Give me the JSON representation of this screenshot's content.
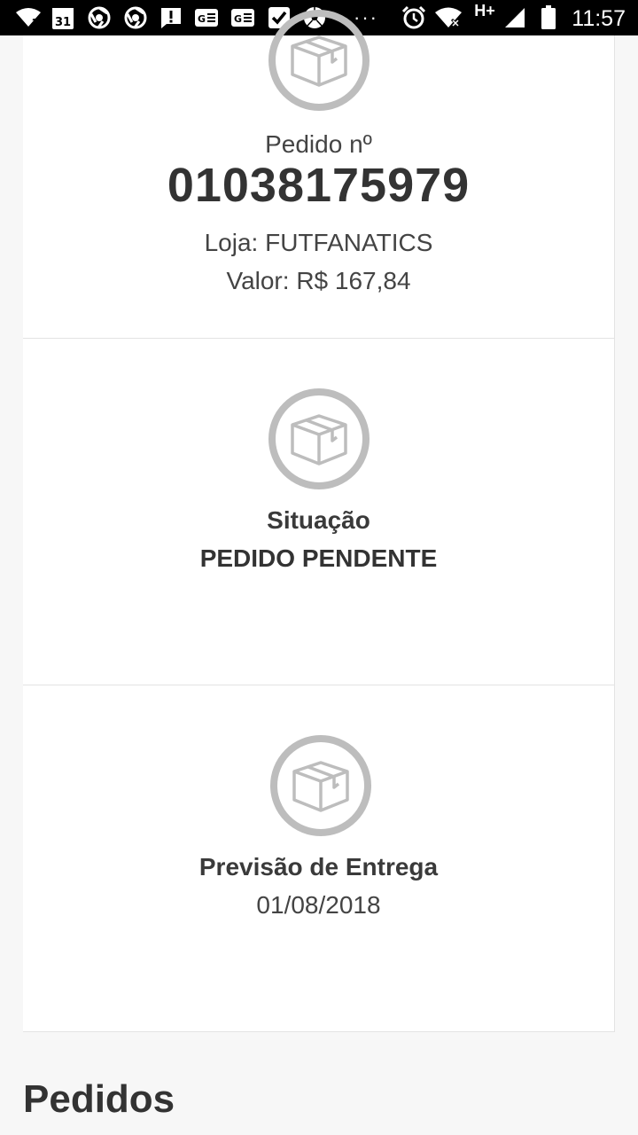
{
  "status_bar": {
    "time": "11:57",
    "calendar_day": "31",
    "network_type": "H+",
    "icons": [
      "wifi-question-icon",
      "calendar-icon",
      "chrome-icon",
      "chrome-icon",
      "alert-message-icon",
      "google-news-icon",
      "google-news-icon",
      "check-icon",
      "soccer-ball-icon",
      "more-dots-icon",
      "alarm-icon",
      "wifi-x-icon",
      "signal-icon",
      "battery-icon"
    ],
    "more_dots": "···"
  },
  "order_card": {
    "label": "Pedido nº",
    "number": "01038175979",
    "store": "Loja: FUTFANATICS",
    "value": "Valor: R$ 167,84",
    "icon": "package-icon"
  },
  "status_card": {
    "title": "Situação",
    "value": "PEDIDO PENDENTE",
    "icon": "package-icon"
  },
  "delivery_card": {
    "title": "Previsão de Entrega",
    "date": "01/08/2018",
    "icon": "package-icon"
  },
  "orders_section": {
    "title": "Pedidos"
  },
  "colors": {
    "status_bar_bg": "#000000",
    "page_bg": "#f7f7f7",
    "card_bg": "#ffffff",
    "icon_gray": "#bdbdbd",
    "text_dark": "#333333"
  }
}
